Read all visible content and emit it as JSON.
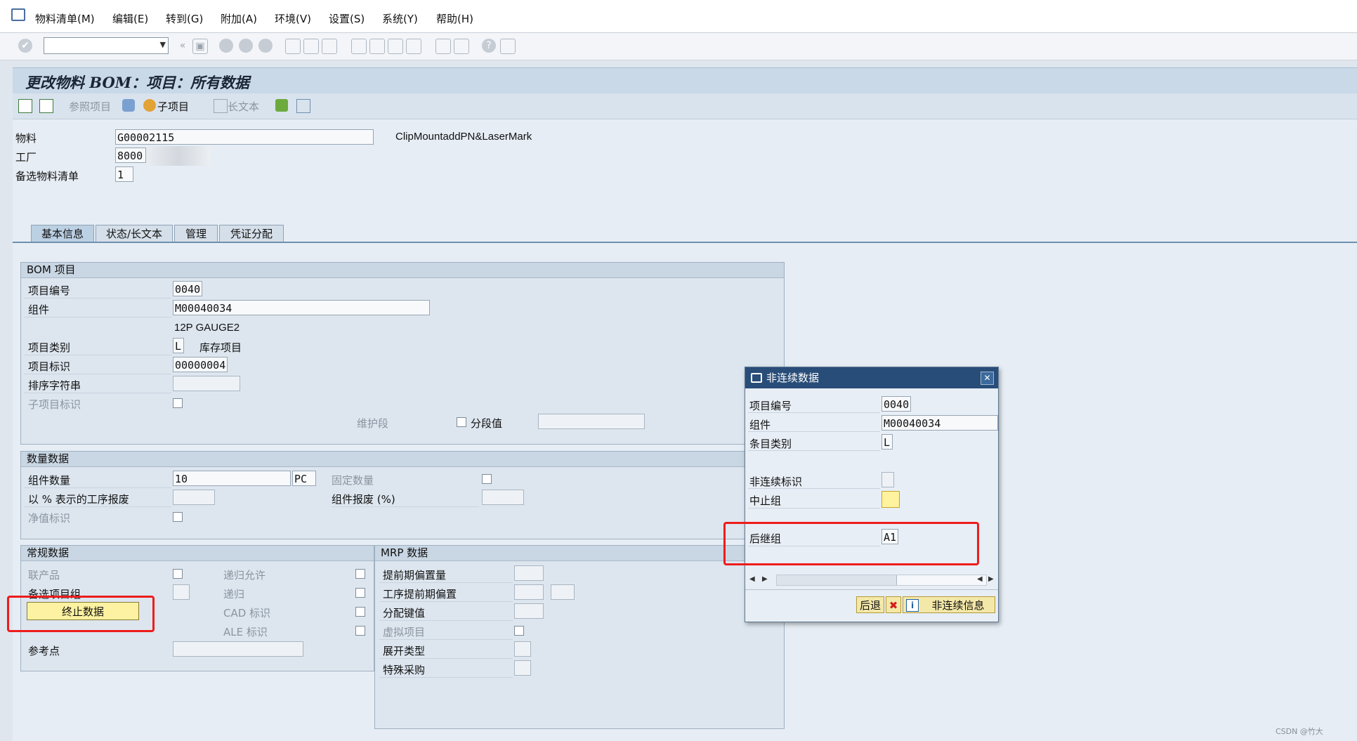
{
  "menubar": {
    "items": [
      "物料清单(M)",
      "编辑(E)",
      "转到(G)",
      "附加(A)",
      "环境(V)",
      "设置(S)",
      "系统(Y)",
      "帮助(H)"
    ]
  },
  "title": "更改物料 BOM：项目：所有数据",
  "app_toolbar": {
    "ref_item": "参照项目",
    "sub_item": "子项目",
    "long_text": "长文本"
  },
  "header": {
    "material_label": "物料",
    "material_value": "G00002115",
    "material_desc": "ClipMountaddPN&LaserMark",
    "plant_label": "工厂",
    "plant_value": "8000",
    "alt_bom_label": "备选物料清单",
    "alt_bom_value": "1"
  },
  "tabs": [
    "基本信息",
    "状态/长文本",
    "管理",
    "凭证分配"
  ],
  "bom_item": {
    "header": "BOM 项目",
    "item_no_label": "项目编号",
    "item_no": "0040",
    "component_label": "组件",
    "component": "M00040034",
    "component_desc": "12P GAUGE2",
    "item_cat_label": "项目类别",
    "item_cat": "L",
    "item_cat_desc": "库存项目",
    "item_id_label": "项目标识",
    "item_id": "00000004",
    "sort_string_label": "排序字符串",
    "sub_item_flag_label": "子项目标识",
    "maint_seg_label": "维护段",
    "seg_value_label": "分段值"
  },
  "qty_data": {
    "header": "数量数据",
    "comp_qty_label": "组件数量",
    "comp_qty": "10",
    "unit": "PC",
    "fixed_qty_label": "固定数量",
    "op_scrap_label": "以 % 表示的工序报废",
    "comp_scrap_label": "组件报废 (%)",
    "net_id_label": "净值标识"
  },
  "general": {
    "header": "常规数据",
    "coproduct_label": "联产品",
    "recursive_allowed_label": "递归允许",
    "alt_item_group_label": "备选项目组",
    "recursive_label": "递归",
    "cad_label": "CAD 标识",
    "ale_label": "ALE 标识",
    "discontinue_btn": "终止数据",
    "ref_point_label": "参考点"
  },
  "mrp": {
    "header": "MRP 数据",
    "lead_offset_label": "提前期偏置量",
    "op_lead_offset_label": "工序提前期偏置",
    "dist_key_label": "分配键值",
    "phantom_label": "虚拟项目",
    "explosion_label": "展开类型",
    "special_proc_label": "特殊采购"
  },
  "dialog": {
    "title": "非连续数据",
    "item_no_label": "项目编号",
    "item_no": "0040",
    "component_label": "组件",
    "component": "M00040034",
    "item_cat_label": "条目类别",
    "item_cat": "L",
    "discont_id_label": "非连续标识",
    "discont_group_label": "中止组",
    "follow_group_label": "后继组",
    "follow_group": "A1",
    "back_btn": "后退",
    "info_btn": "非连续信息"
  },
  "watermark": "CSDN @竹大",
  "colors": {
    "highlight_red": "#ee1c1c",
    "title_bar": "#284d78",
    "yellow_button": "#fdf2a1"
  }
}
